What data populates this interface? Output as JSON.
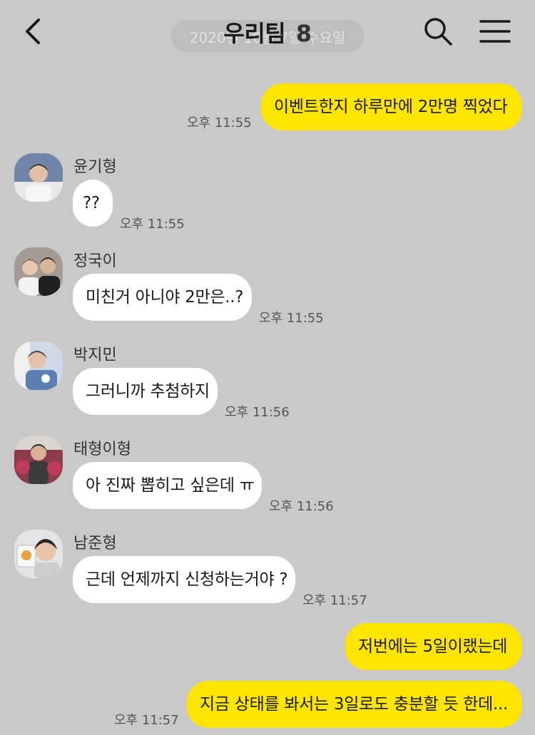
{
  "header": {
    "title": "우리팀",
    "member_count": "8",
    "date_label": "2020년 10월 7일 수요일",
    "icons": {
      "back": "chevron-left-icon",
      "search": "search-icon",
      "menu": "hamburger-menu-icon"
    }
  },
  "colors": {
    "background": "#c9c9c9",
    "my_bubble": "#fee500",
    "other_bubble": "#ffffff"
  },
  "messages": [
    {
      "sender": "me",
      "text": "이벤트한지 하루만에 2만명 찍었다",
      "time": "오후 11:55"
    },
    {
      "sender": "윤기형",
      "text": "??",
      "time": "오후 11:55"
    },
    {
      "sender": "정국이",
      "text": "미친거 아니야 2만은..?",
      "time": "오후 11:55"
    },
    {
      "sender": "박지민",
      "text": "그러니까 추첨하지",
      "time": "오후 11:56"
    },
    {
      "sender": "태형이형",
      "text": "아 진짜 뽑히고 싶은데 ㅠ",
      "time": "오후 11:56"
    },
    {
      "sender": "남준형",
      "text": "근데 언제까지 신청하는거야 ?",
      "time": "오후 11:57"
    },
    {
      "sender": "me",
      "text": "저번에는 5일이랬는데",
      "time": ""
    },
    {
      "sender": "me",
      "text": "지금 상태를 봐서는 3일로도 충분할 듯 한데...",
      "time": "오후 11:57"
    }
  ]
}
